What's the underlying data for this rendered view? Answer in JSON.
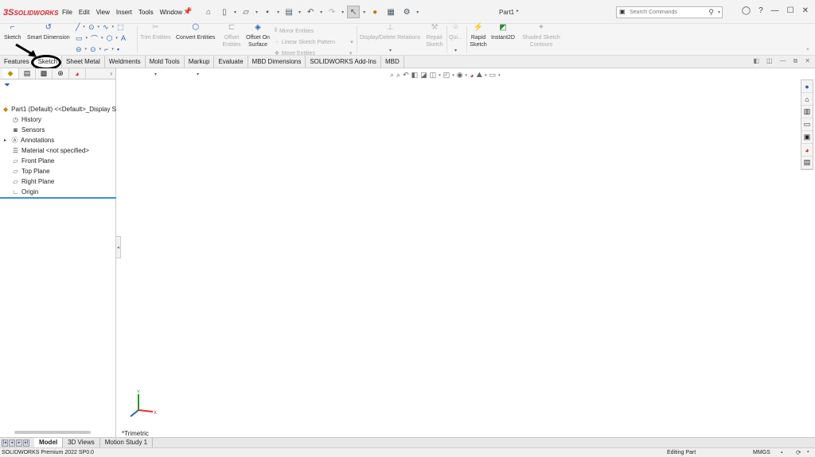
{
  "app": {
    "logo_mark": "3S",
    "logo_text": "SOLIDWORKS",
    "doc_title": "Part1 *"
  },
  "menu": [
    "File",
    "Edit",
    "View",
    "Insert",
    "Tools",
    "Window"
  ],
  "search": {
    "placeholder": "Search Commands"
  },
  "commands": {
    "sketch": "Sketch",
    "smart_dimension": "Smart Dimension",
    "trim_entities": "Trim Entities",
    "convert_entities": "Convert Entities",
    "offset_entities": "Offset Entities",
    "offset_on_surface": "Offset On Surface",
    "mirror_entities": "Mirror Entities",
    "linear_sketch_pattern": "Linear Sketch Pattern",
    "move_entities": "Move Entities",
    "display_delete_relations": "Display/Delete Relations",
    "repair_sketch": "Repair Sketch",
    "quick_snaps": "Qui...",
    "rapid_sketch": "Rapid Sketch",
    "instant2d": "Instant2D",
    "shaded_sketch_contours": "Shaded Sketch Contours"
  },
  "tabs": [
    "Features",
    "Sketch",
    "Sheet Metal",
    "Weldments",
    "Mold Tools",
    "Markup",
    "Evaluate",
    "MBD Dimensions",
    "SOLIDWORKS Add-Ins",
    "MBD"
  ],
  "active_tab": "Sketch",
  "tree": {
    "root": "Part1 (Default) <<Default>_Display S",
    "items": [
      "History",
      "Sensors",
      "Annotations",
      "Material <not specified>",
      "Front Plane",
      "Top Plane",
      "Right Plane",
      "Origin"
    ]
  },
  "viewport": {
    "view_label": "*Trimetric",
    "triad_x": "X",
    "triad_y": "Y"
  },
  "bottom_tabs": [
    "Model",
    "3D Views",
    "Motion Study 1"
  ],
  "status": {
    "version": "SOLIDWORKS Premium 2022 SP0.0",
    "mode": "Editing Part",
    "units": "MMGS"
  },
  "colors": {
    "brand": "#d8262f",
    "accent": "#2a62b0",
    "tree_divider": "#3b8fd6"
  }
}
